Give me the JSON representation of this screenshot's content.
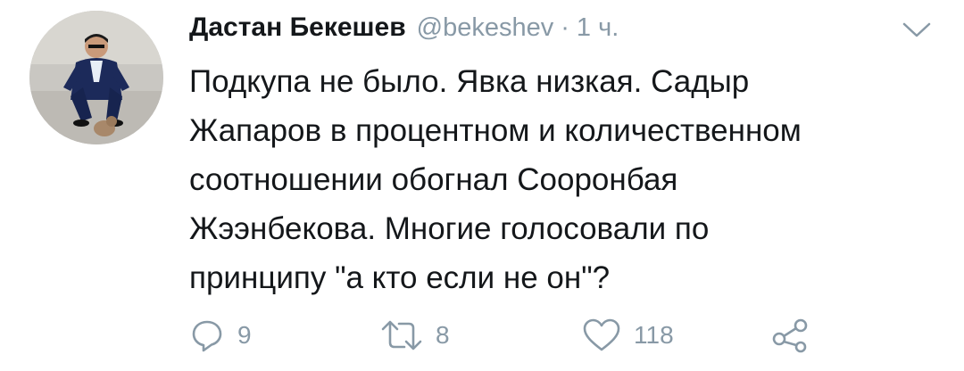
{
  "tweet": {
    "display_name": "Дастан Бекешев",
    "handle": "@bekeshev",
    "separator": "·",
    "time": "1 ч.",
    "text_lines": [
      "Подкупа не было. Явка низкая. Садыр",
      "Жапаров в процентном и количественном",
      "соотношении обогнал Сооронбая",
      "Жээнбекова. Многие голосовали по",
      "принципу \"а кто если не он\"?"
    ],
    "actions": {
      "replies": "9",
      "retweets": "8",
      "likes": "118"
    },
    "icons": {
      "reply": "reply-icon",
      "retweet": "retweet-icon",
      "like": "heart-icon",
      "share": "share-icon",
      "menu": "chevron-down-icon"
    },
    "colors": {
      "text": "#14171a",
      "secondary": "#8899a6"
    }
  }
}
